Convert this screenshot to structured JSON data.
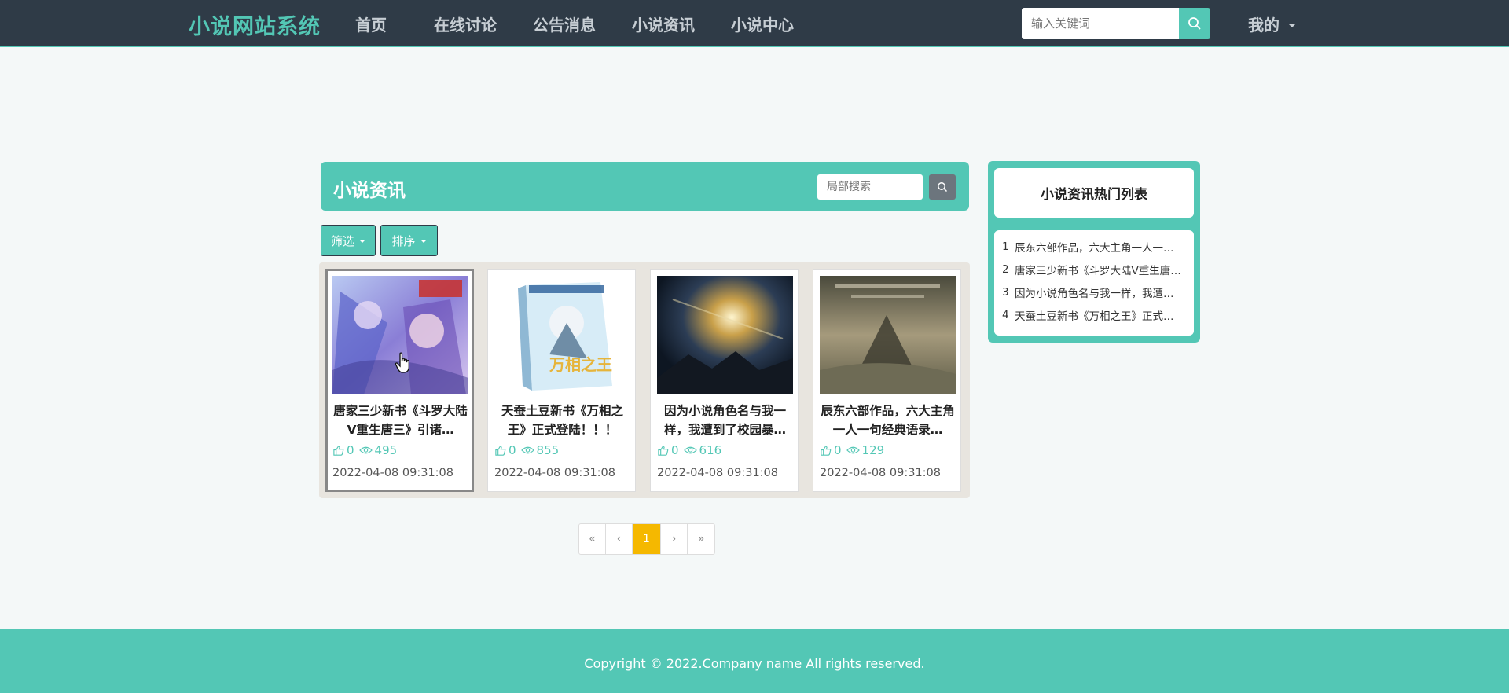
{
  "nav": {
    "brand": "小说网站系统",
    "links": [
      "首页",
      "在线讨论",
      "公告消息",
      "小说资讯",
      "小说中心"
    ],
    "search_placeholder": "输入关键词",
    "mine": "我的"
  },
  "section": {
    "title": "小说资讯",
    "local_search_placeholder": "局部搜索",
    "filter_label": "筛选",
    "sort_label": "排序"
  },
  "cards": [
    {
      "title": "唐家三少新书《斗罗大陆V重生唐三》引诸…",
      "likes": "0",
      "views": "495",
      "date": "2022-04-08 09:31:08"
    },
    {
      "title": "天蚕土豆新书《万相之王》正式登陆！！！",
      "likes": "0",
      "views": "855",
      "date": "2022-04-08 09:31:08"
    },
    {
      "title": "因为小说角色名与我一样，我遭到了校园暴…",
      "likes": "0",
      "views": "616",
      "date": "2022-04-08 09:31:08"
    },
    {
      "title": "辰东六部作品，六大主角一人一句经典语录…",
      "likes": "0",
      "views": "129",
      "date": "2022-04-08 09:31:08"
    }
  ],
  "pagination": {
    "first": "«",
    "prev": "‹",
    "current": "1",
    "next": "›",
    "last": "»"
  },
  "side": {
    "title": "小说资讯热门列表",
    "items": [
      {
        "idx": "1",
        "text": "辰东六部作品，六大主角一人一…"
      },
      {
        "idx": "2",
        "text": "唐家三少新书《斗罗大陆V重生唐…"
      },
      {
        "idx": "3",
        "text": "因为小说角色名与我一样，我遭…"
      },
      {
        "idx": "4",
        "text": "天蚕土豆新书《万相之王》正式…"
      }
    ]
  },
  "footer": {
    "copyright": "Copyright © 2022.Company name All rights reserved."
  },
  "colors": {
    "accent": "#53c7b5",
    "nav_bg": "#2f3b47",
    "page_active": "#f5b800"
  }
}
